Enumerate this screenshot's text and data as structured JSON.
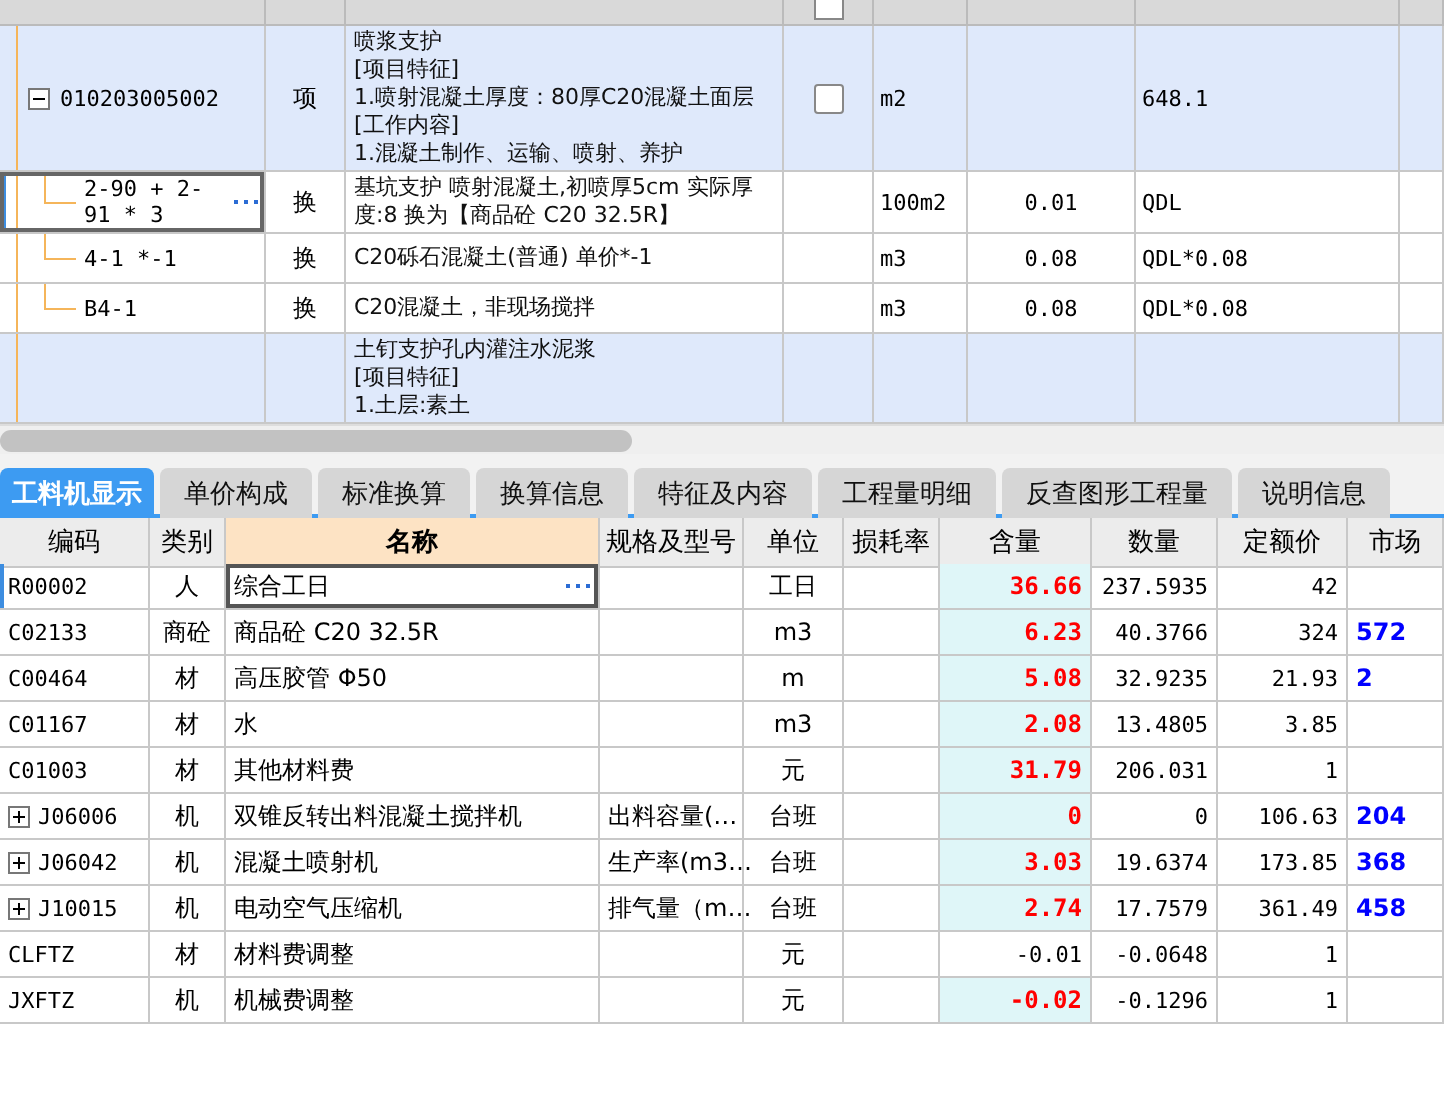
{
  "header_checkbox": {
    "checked": false
  },
  "bill_rows": [
    {
      "kind": "item",
      "selected": false,
      "expanded": true,
      "code": "010203005002",
      "type": "项",
      "name": "喷浆支护\n[项目特征]\n1.喷射混凝土厚度：80厚C20混凝土面层\n[工作内容]\n1.混凝土制作、运输、喷射、养护",
      "checked": false,
      "unit": "m2",
      "column_7": "648.1"
    },
    {
      "kind": "sub",
      "selected": true,
      "code": "2-90 + 2-91 * 3",
      "type": "换",
      "name": "基坑支护 喷射混凝土,初喷厚5cm  实际厚度:8  换为【商品砼 C20 32.5R】",
      "unit": "100m2",
      "column_6": "0.01",
      "column_7": "QDL"
    },
    {
      "kind": "sub",
      "selected": false,
      "code": "4-1 *-1",
      "type": "换",
      "name": "C20砾石混凝土(普通)  单价*-1",
      "unit": "m3",
      "column_6": "0.08",
      "column_7": "QDL*0.08"
    },
    {
      "kind": "sub",
      "selected": false,
      "code": "B4-1",
      "type": "换",
      "name": "C20混凝土，非现场搅拌",
      "unit": "m3",
      "column_6": "0.08",
      "column_7": "QDL*0.08"
    },
    {
      "kind": "item",
      "selected": false,
      "name": "土钉支护孔内灌注水泥浆\n[项目特征]\n1.土层:素土"
    }
  ],
  "tabs": [
    {
      "label": "工料机显示",
      "selected": true
    },
    {
      "label": "单价构成",
      "selected": false
    },
    {
      "label": "标准换算",
      "selected": false
    },
    {
      "label": "换算信息",
      "selected": false
    },
    {
      "label": "特征及内容",
      "selected": false
    },
    {
      "label": "工程量明细",
      "selected": false
    },
    {
      "label": "反查图形工程量",
      "selected": false
    },
    {
      "label": "说明信息",
      "selected": false
    }
  ],
  "resource_table": {
    "columns": [
      {
        "label": "编码",
        "selected": false
      },
      {
        "label": "类别",
        "selected": false
      },
      {
        "label": "名称",
        "selected": true
      },
      {
        "label": "规格及型号",
        "selected": false
      },
      {
        "label": "单位",
        "selected": false
      },
      {
        "label": "损耗率",
        "selected": false
      },
      {
        "label": "含量",
        "selected": false
      },
      {
        "label": "数量",
        "selected": false
      },
      {
        "label": "定额价",
        "selected": false
      },
      {
        "label": "市场",
        "selected": false
      }
    ],
    "rows": [
      {
        "selected": true,
        "code": "R00002",
        "category": "人",
        "name": "综合工日",
        "unit": "工日",
        "content": "36.66",
        "highlighted": true,
        "quantity": "237.5935",
        "base_price": "42"
      },
      {
        "selected": false,
        "code": "C02133",
        "category": "商砼",
        "name": "商品砼 C20 32.5R",
        "unit": "m3",
        "content": "6.23",
        "highlighted": true,
        "quantity": "40.3766",
        "base_price": "324",
        "market_price": "572"
      },
      {
        "selected": false,
        "code": "C00464",
        "category": "材",
        "name": "高压胶管 Φ50",
        "unit": "m",
        "content": "5.08",
        "highlighted": true,
        "quantity": "32.9235",
        "base_price": "21.93",
        "market_price": "2"
      },
      {
        "selected": false,
        "code": "C01167",
        "category": "材",
        "name": "水",
        "unit": "m3",
        "content": "2.08",
        "highlighted": true,
        "quantity": "13.4805",
        "base_price": "3.85"
      },
      {
        "selected": false,
        "code": "C01003",
        "category": "材",
        "name": "其他材料费",
        "unit": "元",
        "content": "31.79",
        "highlighted": true,
        "quantity": "206.031",
        "base_price": "1"
      },
      {
        "selected": false,
        "expanded": false,
        "code": "J06006",
        "category": "机",
        "name": "双锥反转出料混凝土搅拌机",
        "spec": "出料容量(…",
        "unit": "台班",
        "content": "0",
        "highlighted": true,
        "quantity": "0",
        "base_price": "106.63",
        "market_price": "204"
      },
      {
        "selected": false,
        "expanded": false,
        "code": "J06042",
        "category": "机",
        "name": "混凝土喷射机",
        "spec": "生产率(m3…",
        "unit": "台班",
        "content": "3.03",
        "highlighted": true,
        "quantity": "19.6374",
        "base_price": "173.85",
        "market_price": "368"
      },
      {
        "selected": false,
        "expanded": false,
        "code": "J10015",
        "category": "机",
        "name": "电动空气压缩机",
        "spec": "排气量（m…",
        "unit": "台班",
        "content": "2.74",
        "highlighted": true,
        "quantity": "17.7579",
        "base_price": "361.49",
        "market_price": "458"
      },
      {
        "selected": false,
        "code": "CLFTZ",
        "category": "材",
        "name": "材料费调整",
        "unit": "元",
        "content": "-0.01",
        "highlighted": false,
        "quantity": "-0.0648",
        "base_price": "1"
      },
      {
        "selected": false,
        "code": "JXFTZ",
        "category": "机",
        "name": "机械费调整",
        "unit": "元",
        "content": "-0.02",
        "highlighted": true,
        "quantity": "-0.1296",
        "base_price": "1"
      }
    ]
  }
}
